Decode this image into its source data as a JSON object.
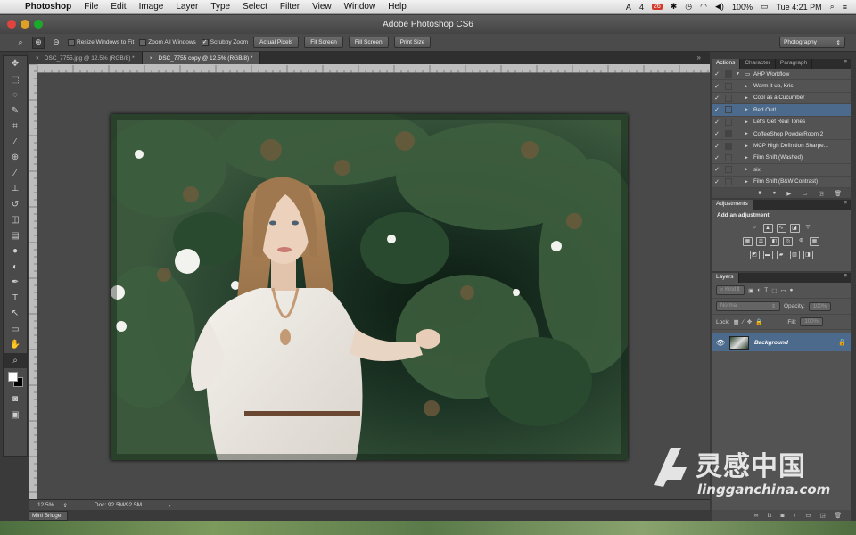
{
  "menubar": {
    "apple": "",
    "app": "Photoshop",
    "items": [
      "File",
      "Edit",
      "Image",
      "Layer",
      "Type",
      "Select",
      "Filter",
      "View",
      "Window",
      "Help"
    ],
    "status": {
      "adobe_count": "4",
      "badge": "26",
      "battery": "100%",
      "clock": "Tue 4:21 PM"
    }
  },
  "window": {
    "title": "Adobe Photoshop CS6"
  },
  "options": {
    "resize_windows": "Resize Windows to Fit",
    "zoom_all": "Zoom All Windows",
    "scrubby": "Scrubby Zoom",
    "scrubby_checked": "✓",
    "actual_pixels": "Actual Pixels",
    "fit_screen": "Fit Screen",
    "fill_screen": "Fill Screen",
    "print_size": "Print Size",
    "workspace": "Photography"
  },
  "tabs": [
    {
      "label": "DSC_7755.jpg @ 12.5% (RGB/8) *"
    },
    {
      "label": "DSC_7755 copy @ 12.5% (RGB/8) *"
    }
  ],
  "status": {
    "zoom": "12.5%",
    "doc": "Doc: 92.5M/92.5M"
  },
  "mini_bridge": "Mini Bridge",
  "panels": {
    "actions_tabs": [
      "Actions",
      "Character",
      "Paragraph"
    ],
    "actions": [
      {
        "name": "AHP Workflow",
        "folder": true
      },
      {
        "name": "Warm it up, Kris!"
      },
      {
        "name": "Cool as a Cucumber"
      },
      {
        "name": "Red Out!",
        "selected": true
      },
      {
        "name": "Let's Get Real Tones"
      },
      {
        "name": "CoffeeShop PowderRoom 2"
      },
      {
        "name": "MCP High Definition Sharpe..."
      },
      {
        "name": "Film Shift (Washed)"
      },
      {
        "name": "six"
      },
      {
        "name": "Film Shift (B&W Contrast)"
      }
    ],
    "adjustments_tab": "Adjustments",
    "adjustments_title": "Add an adjustment",
    "layers_tab": "Layers",
    "layers": {
      "kind": "Kind",
      "blend": "Normal",
      "opacity_label": "Opacity:",
      "opacity": "100%",
      "lock_label": "Lock:",
      "fill_label": "Fill:",
      "fill": "100%",
      "items": [
        {
          "name": "Background"
        }
      ]
    }
  },
  "watermark": {
    "cn": "灵感中国",
    "en": "lingganchina.com"
  }
}
